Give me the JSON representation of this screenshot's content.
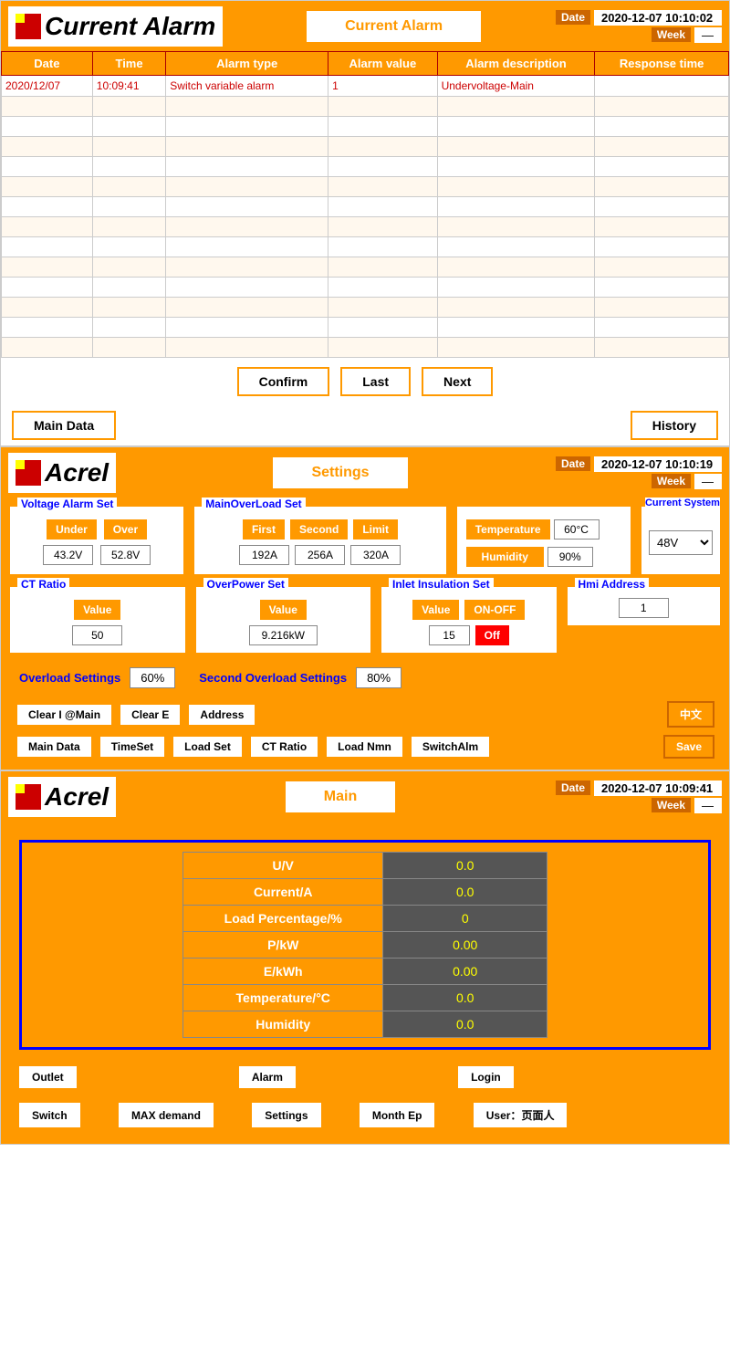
{
  "section1": {
    "header": {
      "title": "Current Alarm",
      "date_label": "Date",
      "date_value": "2020-12-07 10:10:02",
      "week_label": "Week",
      "week_value": "—"
    },
    "table": {
      "columns": [
        "Date",
        "Time",
        "Alarm type",
        "Alarm value",
        "Alarm description",
        "Response time"
      ],
      "rows": [
        [
          "2020/12/07",
          "10:09:41",
          "Switch variable alarm",
          "1",
          "Undervoltage-Main",
          ""
        ],
        [
          "",
          "",
          "",
          "",
          "",
          ""
        ],
        [
          "",
          "",
          "",
          "",
          "",
          ""
        ],
        [
          "",
          "",
          "",
          "",
          "",
          ""
        ],
        [
          "",
          "",
          "",
          "",
          "",
          ""
        ],
        [
          "",
          "",
          "",
          "",
          "",
          ""
        ],
        [
          "",
          "",
          "",
          "",
          "",
          ""
        ],
        [
          "",
          "",
          "",
          "",
          "",
          ""
        ],
        [
          "",
          "",
          "",
          "",
          "",
          ""
        ],
        [
          "",
          "",
          "",
          "",
          "",
          ""
        ],
        [
          "",
          "",
          "",
          "",
          "",
          ""
        ],
        [
          "",
          "",
          "",
          "",
          "",
          ""
        ],
        [
          "",
          "",
          "",
          "",
          "",
          ""
        ],
        [
          "",
          "",
          "",
          "",
          "",
          ""
        ]
      ]
    },
    "buttons": {
      "confirm": "Confirm",
      "last": "Last",
      "next": "Next",
      "main_data": "Main Data",
      "history": "History"
    }
  },
  "section2": {
    "header": {
      "title": "Settings",
      "date_label": "Date",
      "date_value": "2020-12-07 10:10:19",
      "week_label": "Week",
      "week_value": "—"
    },
    "voltage_alarm": {
      "label": "Voltage Alarm Set",
      "under_btn": "Under",
      "over_btn": "Over",
      "under_val": "43.2V",
      "over_val": "52.8V"
    },
    "main_overload": {
      "label": "MainOverLoad Set",
      "first_btn": "First",
      "second_btn": "Second",
      "limit_btn": "Limit",
      "first_val": "192A",
      "second_val": "256A",
      "limit_val": "320A"
    },
    "temp_humidity": {
      "temp_btn": "Temperature",
      "temp_val": "60°C",
      "hum_btn": "Humidity",
      "hum_val": "90%"
    },
    "current_system": {
      "label": "Current System",
      "options": [
        "48V"
      ],
      "selected": "48V"
    },
    "ct_ratio": {
      "label": "CT Ratio",
      "value_btn": "Value",
      "value": "50"
    },
    "overpower": {
      "label": "OverPower Set",
      "value_btn": "Value",
      "value": "9.216kW"
    },
    "inlet_insulation": {
      "label": "Inlet Insulation Set",
      "value_btn": "Value",
      "on_off_btn": "ON-OFF",
      "value": "15",
      "on_off_val": "Off"
    },
    "hmi_address": {
      "label": "Hmi Address",
      "value": "1"
    },
    "overload_settings": {
      "label": "Overload Settings",
      "value": "60%",
      "second_label": "Second Overload Settings",
      "second_value": "80%"
    },
    "action_btns": {
      "clear_i": "Clear I @Main",
      "clear_e": "Clear E",
      "address": "Address",
      "chinese": "中文",
      "main_data": "Main Data",
      "time_set": "TimeSet",
      "load_set": "Load Set",
      "ct_ratio": "CT Ratio",
      "load_nmn": "Load Nmn",
      "switch_alm": "SwitchAlm",
      "save": "Save"
    }
  },
  "section3": {
    "header": {
      "title": "Main",
      "date_label": "Date",
      "date_value": "2020-12-07 10:09:41",
      "week_label": "Week",
      "week_value": "—"
    },
    "data_rows": [
      {
        "label": "U/V",
        "value": "0.0"
      },
      {
        "label": "Current/A",
        "value": "0.0"
      },
      {
        "label": "Load Percentage/%",
        "value": "0"
      },
      {
        "label": "P/kW",
        "value": "0.00"
      },
      {
        "label": "E/kWh",
        "value": "0.00"
      },
      {
        "label": "Temperature/°C",
        "value": "0.0"
      },
      {
        "label": "Humidity",
        "value": "0.0"
      }
    ],
    "nav_btns": {
      "outlet": "Outlet",
      "alarm": "Alarm",
      "login": "Login",
      "switch": "Switch",
      "max_demand": "MAX demand",
      "settings": "Settings",
      "month_ep": "Month Ep",
      "user_label": "User：",
      "user_name": "页面人"
    }
  }
}
